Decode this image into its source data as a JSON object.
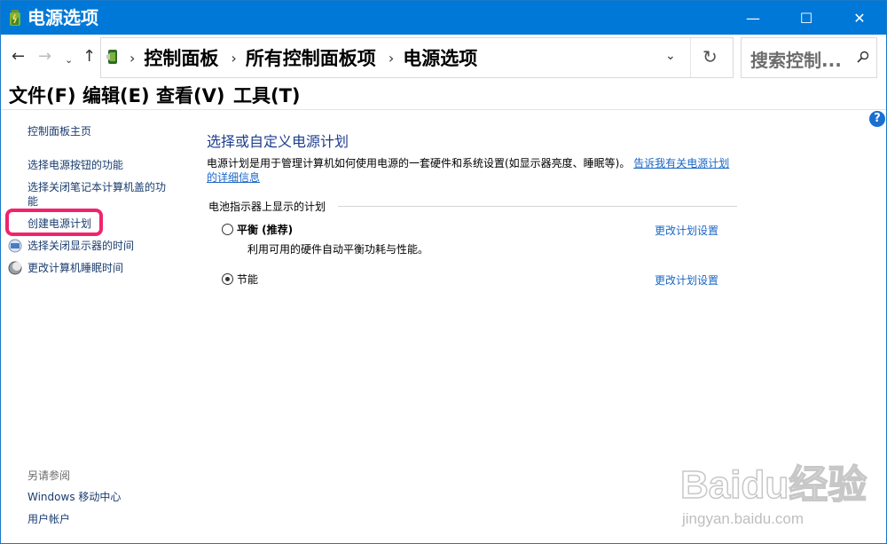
{
  "window": {
    "title": "电源选项",
    "controls": {
      "minimize": "—",
      "maximize": "☐",
      "close": "✕"
    }
  },
  "nav": {
    "back": "←",
    "forward": "→",
    "recent": "⌄",
    "up": "↑",
    "breadcrumbs": [
      "控制面板",
      "所有控制面板项",
      "电源选项"
    ],
    "separator": "›",
    "dropdown": "⌄",
    "refresh": "↻",
    "search_placeholder": "搜索控制..."
  },
  "menu": {
    "file": "文件(F)",
    "edit": "编辑(E)",
    "view": "查看(V)",
    "tools": "工具(T)"
  },
  "help": "?",
  "sidebar": {
    "home": "控制面板主页",
    "items": [
      "选择电源按钮的功能",
      "选择关闭笔记本计算机盖的功",
      "能",
      "创建电源计划",
      "选择关闭显示器的时间",
      "更改计算机睡眠时间"
    ],
    "see_also_label": "另请参阅",
    "see_also": [
      "Windows 移动中心",
      "用户帐户"
    ]
  },
  "main": {
    "heading": "选择或自定义电源计划",
    "description": "电源计划是用于管理计算机如何使用电源的一套硬件和系统设置(如显示器亮度、睡眠等)。",
    "description_link": "告诉我有关电源计划的详细信息",
    "section_label": "电池指示器上显示的计划",
    "plans": [
      {
        "name": "平衡 (推荐)",
        "description": "利用可用的硬件自动平衡功耗与性能。",
        "selected": false,
        "link": "更改计划设置"
      },
      {
        "name": "节能",
        "description": "",
        "selected": true,
        "link": "更改计划设置"
      }
    ]
  },
  "watermark": {
    "text": "Baidu经验",
    "sub": "jingyan.baidu.com"
  },
  "colors": {
    "titlebar": "#0078d7",
    "link": "#1a66c6",
    "heading": "#1e3f8f",
    "highlight": "#f0246e"
  }
}
